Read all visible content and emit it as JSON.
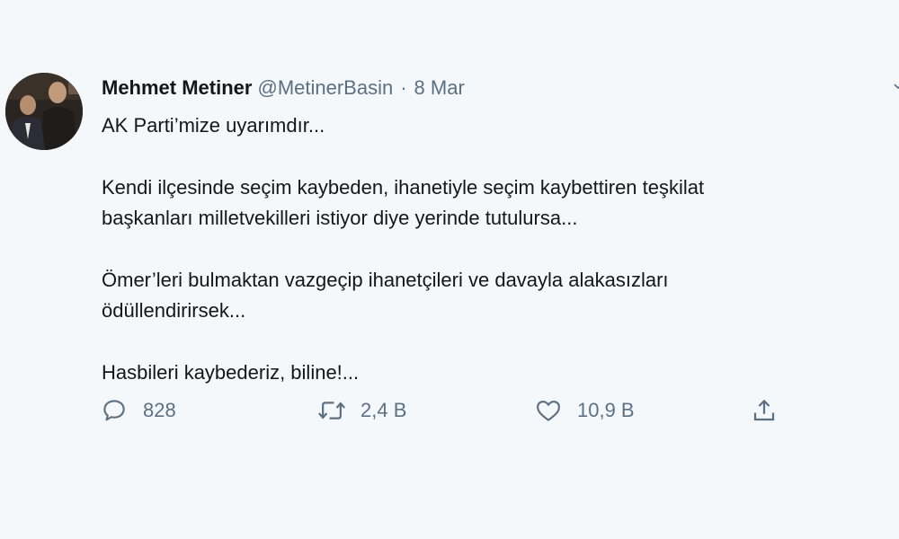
{
  "tweet": {
    "author_name": "Mehmet Metiner",
    "author_handle": "@MetinerBasin",
    "separator": "·",
    "date": "8 Mar",
    "paragraphs": [
      [
        "AK Parti’mize uyarımdır..."
      ],
      [
        "Kendi ilçesinde seçim kaybeden, ihanetiyle seçim kaybettiren teşkilat",
        "başkanları milletvekilleri istiyor diye yerinde tutulursa..."
      ],
      [
        "Ömer’leri bulmaktan vazgeçip ihanetçileri ve davayla alakasızları",
        "ödüllendirirsek..."
      ],
      [
        "Hasbileri kaybederiz, biline!..."
      ]
    ],
    "actions": {
      "reply_count": "828",
      "retweet_count": "2,4 B",
      "like_count": "10,9 B"
    },
    "icons": {
      "reply": "reply-icon",
      "retweet": "retweet-icon",
      "like": "heart-icon",
      "share": "share-icon",
      "more": "chevron-down-icon"
    },
    "colors": {
      "background": "#f5f8fa",
      "text": "#14171a",
      "secondary": "#5b7083"
    }
  }
}
